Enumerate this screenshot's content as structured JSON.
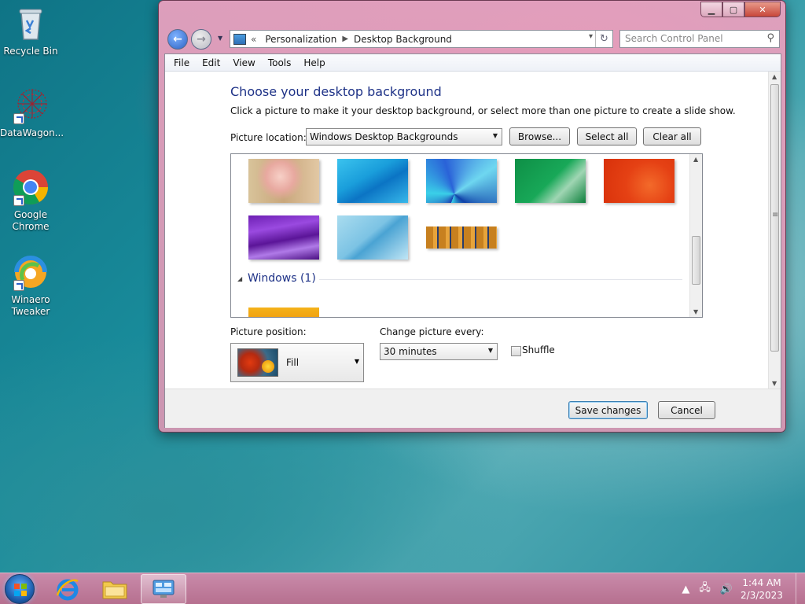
{
  "desktop": {
    "icons": [
      {
        "label": "Recycle Bin"
      },
      {
        "label": "DataWagon..."
      },
      {
        "label": "Google Chrome"
      },
      {
        "label": "Winaero Tweaker"
      }
    ]
  },
  "window": {
    "breadcrumb": {
      "root_glyph": "«",
      "items": [
        "Personalization",
        "Desktop Background"
      ]
    },
    "search_placeholder": "Search Control Panel",
    "menu": [
      "File",
      "Edit",
      "View",
      "Tools",
      "Help"
    ],
    "heading": "Choose your desktop background",
    "subtitle": "Click a picture to make it your desktop background, or select more than one picture to create a slide show.",
    "picture_location": {
      "label": "Picture location:",
      "value": "Windows Desktop Backgrounds"
    },
    "buttons": {
      "browse": "Browse...",
      "select_all": "Select all",
      "clear_all": "Clear all",
      "save": "Save changes",
      "cancel": "Cancel"
    },
    "group_header": "Windows (1)",
    "picture_position": {
      "label": "Picture position:",
      "value": "Fill"
    },
    "change_every": {
      "label": "Change picture every:",
      "value": "30 minutes"
    },
    "shuffle": {
      "label": "Shuffle",
      "checked": false
    }
  },
  "taskbar": {
    "time": "1:44 AM",
    "date": "2/3/2023"
  }
}
